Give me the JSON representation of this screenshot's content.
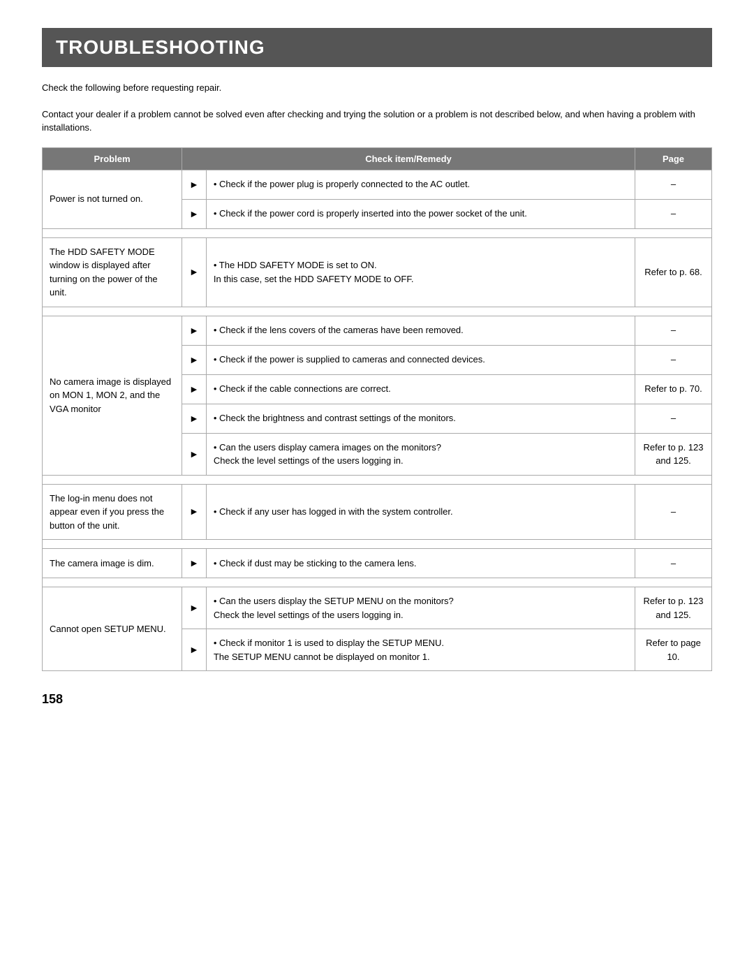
{
  "title": "TROUBLESHOOTING",
  "intro": [
    "Check the following before requesting repair.",
    "Contact your dealer if a problem cannot be solved even after checking and trying the solution or a problem is not described below, and when having a problem with installations."
  ],
  "headers": {
    "problem": "Problem",
    "remedy": "Check item/Remedy",
    "page": "Page"
  },
  "rows": [
    {
      "problem": "Power is not turned on.",
      "remedies": [
        {
          "text": "• Check if the power plug is properly connected to the AC outlet.",
          "page": "–"
        },
        {
          "text": "• Check if the power cord is properly inserted into the power socket of the unit.",
          "page": "–"
        }
      ]
    },
    {
      "problem": "The HDD SAFETY MODE window is displayed after turning on the power of the unit.",
      "remedies": [
        {
          "text": "• The HDD SAFETY MODE is set to ON.\nIn this case, set the HDD SAFETY MODE to OFF.",
          "page": "Refer to p. 68."
        }
      ]
    },
    {
      "problem": "No camera image is displayed on MON 1, MON 2, and the VGA monitor",
      "remedies": [
        {
          "text": "• Check if the lens covers of the cameras have been removed.",
          "page": "–"
        },
        {
          "text": "• Check if the power is supplied to cameras and connected devices.",
          "page": "–"
        },
        {
          "text": "• Check if the cable connections are correct.",
          "page": "Refer to p. 70."
        },
        {
          "text": "• Check the brightness and contrast settings of the monitors.",
          "page": "–"
        },
        {
          "text": "• Can the users display camera images on the monitors?\nCheck the level settings of the users logging in.",
          "page": "Refer to p. 123 and 125."
        }
      ]
    },
    {
      "problem": "The log-in menu does not appear even if you press the button of the unit.",
      "remedies": [
        {
          "text": "• Check if any user has logged in with the system controller.",
          "page": "–"
        }
      ]
    },
    {
      "problem": "The camera image is dim.",
      "remedies": [
        {
          "text": "• Check if dust may be sticking to the camera lens.",
          "page": "–"
        }
      ]
    },
    {
      "problem": "Cannot open SETUP MENU.",
      "remedies": [
        {
          "text": "• Can the users display the SETUP MENU on the monitors?\nCheck the level settings of the users logging in.",
          "page": "Refer to p. 123 and 125."
        },
        {
          "text": "• Check if monitor 1 is used to display the SETUP MENU.\nThe SETUP MENU cannot be displayed on monitor 1.",
          "page": "Refer to page 10."
        }
      ]
    }
  ],
  "page_number": "158"
}
